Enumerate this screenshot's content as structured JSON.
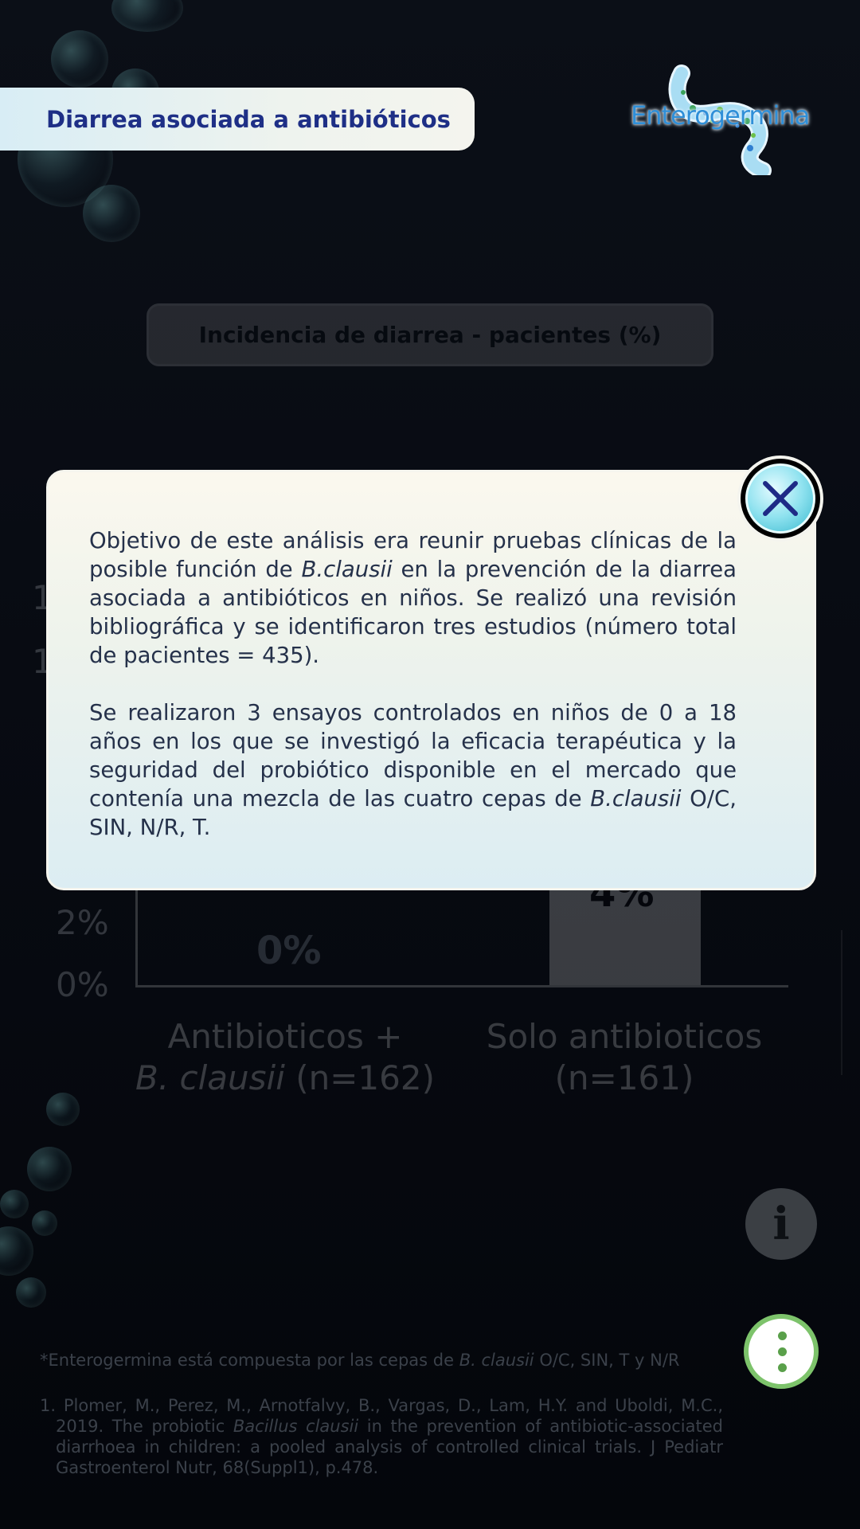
{
  "header": {
    "title": "Diarrea asociada a antibióticos",
    "logo_text": "Enterogermina"
  },
  "chart_data": {
    "type": "bar",
    "title": "Incidencia de diarrea - pacientes (%)",
    "y_ticks_visible": [
      "1",
      "1",
      "2%",
      "0%"
    ],
    "categories": [
      {
        "line1": "Antibioticos +",
        "line2_italic": "B. clausii",
        "line2_rest": " (n=162)"
      },
      {
        "line1": "Solo antibioticos",
        "line2_italic": "",
        "line2_rest": "(n=161)"
      }
    ],
    "values": [
      0,
      4
    ],
    "value_labels": [
      "0%",
      "4%"
    ]
  },
  "modal": {
    "p1_a": "Objetivo de este análisis era reunir pruebas clínicas de la posible función de ",
    "p1_italic": "B.clausii",
    "p1_b": " en la prevención de la diarrea asociada a antibióticos en niños. Se realizó una revisión bibliográfica y se identificaron tres estudios (número total de pacientes = 435).",
    "p2_a": "Se realizaron 3 ensayos controlados en niños de 0 a 18 años en los que se investigó la eficacia terapéutica y la seguridad del probiótico disponible en el mercado que contenía una mezcla de las cuatro cepas de ",
    "p2_italic": "B.clausii",
    "p2_b": " O/C, SIN, N/R, T."
  },
  "buttons": {
    "info_glyph": "i"
  },
  "footnotes": {
    "star_a": "*Enterogermina está compuesta por las cepas de ",
    "star_italic": "B. clausii",
    "star_b": " O/C, SIN, T y N/R",
    "ref_a": "1. Plomer, M., Perez, M., Arnotfalvy, B., Vargas, D., Lam, H.Y. and Uboldi, M.C., 2019. The probiotic ",
    "ref_italic": "Bacillus clausii",
    "ref_b": " in the prevention of antibiotic-associated diarrhoea in children: a pooled analysis of controlled clinical trials. J Pediatr Gastroenterol Nutr, 68(Suppl1), p.478."
  },
  "colors": {
    "title_text": "#1e2f86",
    "menu_ring": "#7dc36b",
    "close_fill": "#39b9cf"
  }
}
